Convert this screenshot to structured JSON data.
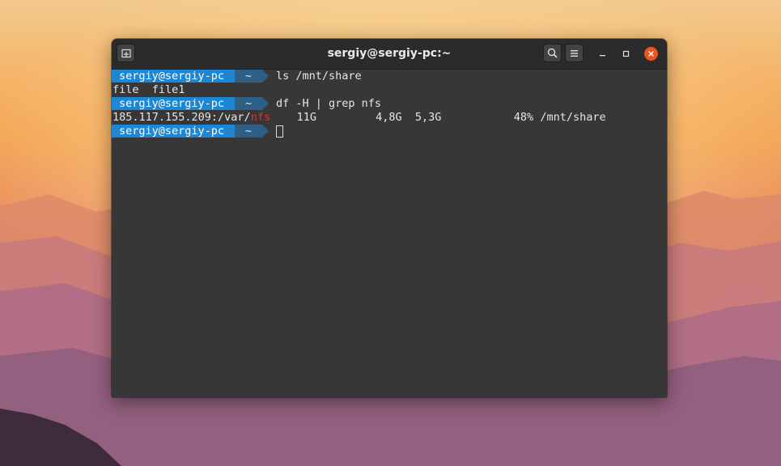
{
  "window": {
    "title": "sergiy@sergiy-pc:~"
  },
  "titlebar": {
    "new_tab_icon": "new-tab-icon",
    "search_icon": "search-icon",
    "menu_icon": "hamburger-menu-icon",
    "minimize_icon": "minimize-icon",
    "maximize_icon": "maximize-icon",
    "close_icon": "close-icon"
  },
  "colors": {
    "prompt_user_bg": "#1d87d6",
    "prompt_dir_bg": "#2e5f86",
    "terminal_bg": "#373737",
    "highlight": "#ef2929",
    "close_button": "#e95420"
  },
  "terminal": {
    "prompt_user": "sergiy@sergiy-pc",
    "prompt_dir": "~",
    "command1": "ls /mnt/share",
    "output1": "file  file1",
    "command2": "df -H | grep nfs",
    "output2_prefix": "185.117.155.209:/var/",
    "output2_match": "nfs",
    "output2_rest": "    11G         4,8G  5,3G           48% /mnt/share"
  }
}
